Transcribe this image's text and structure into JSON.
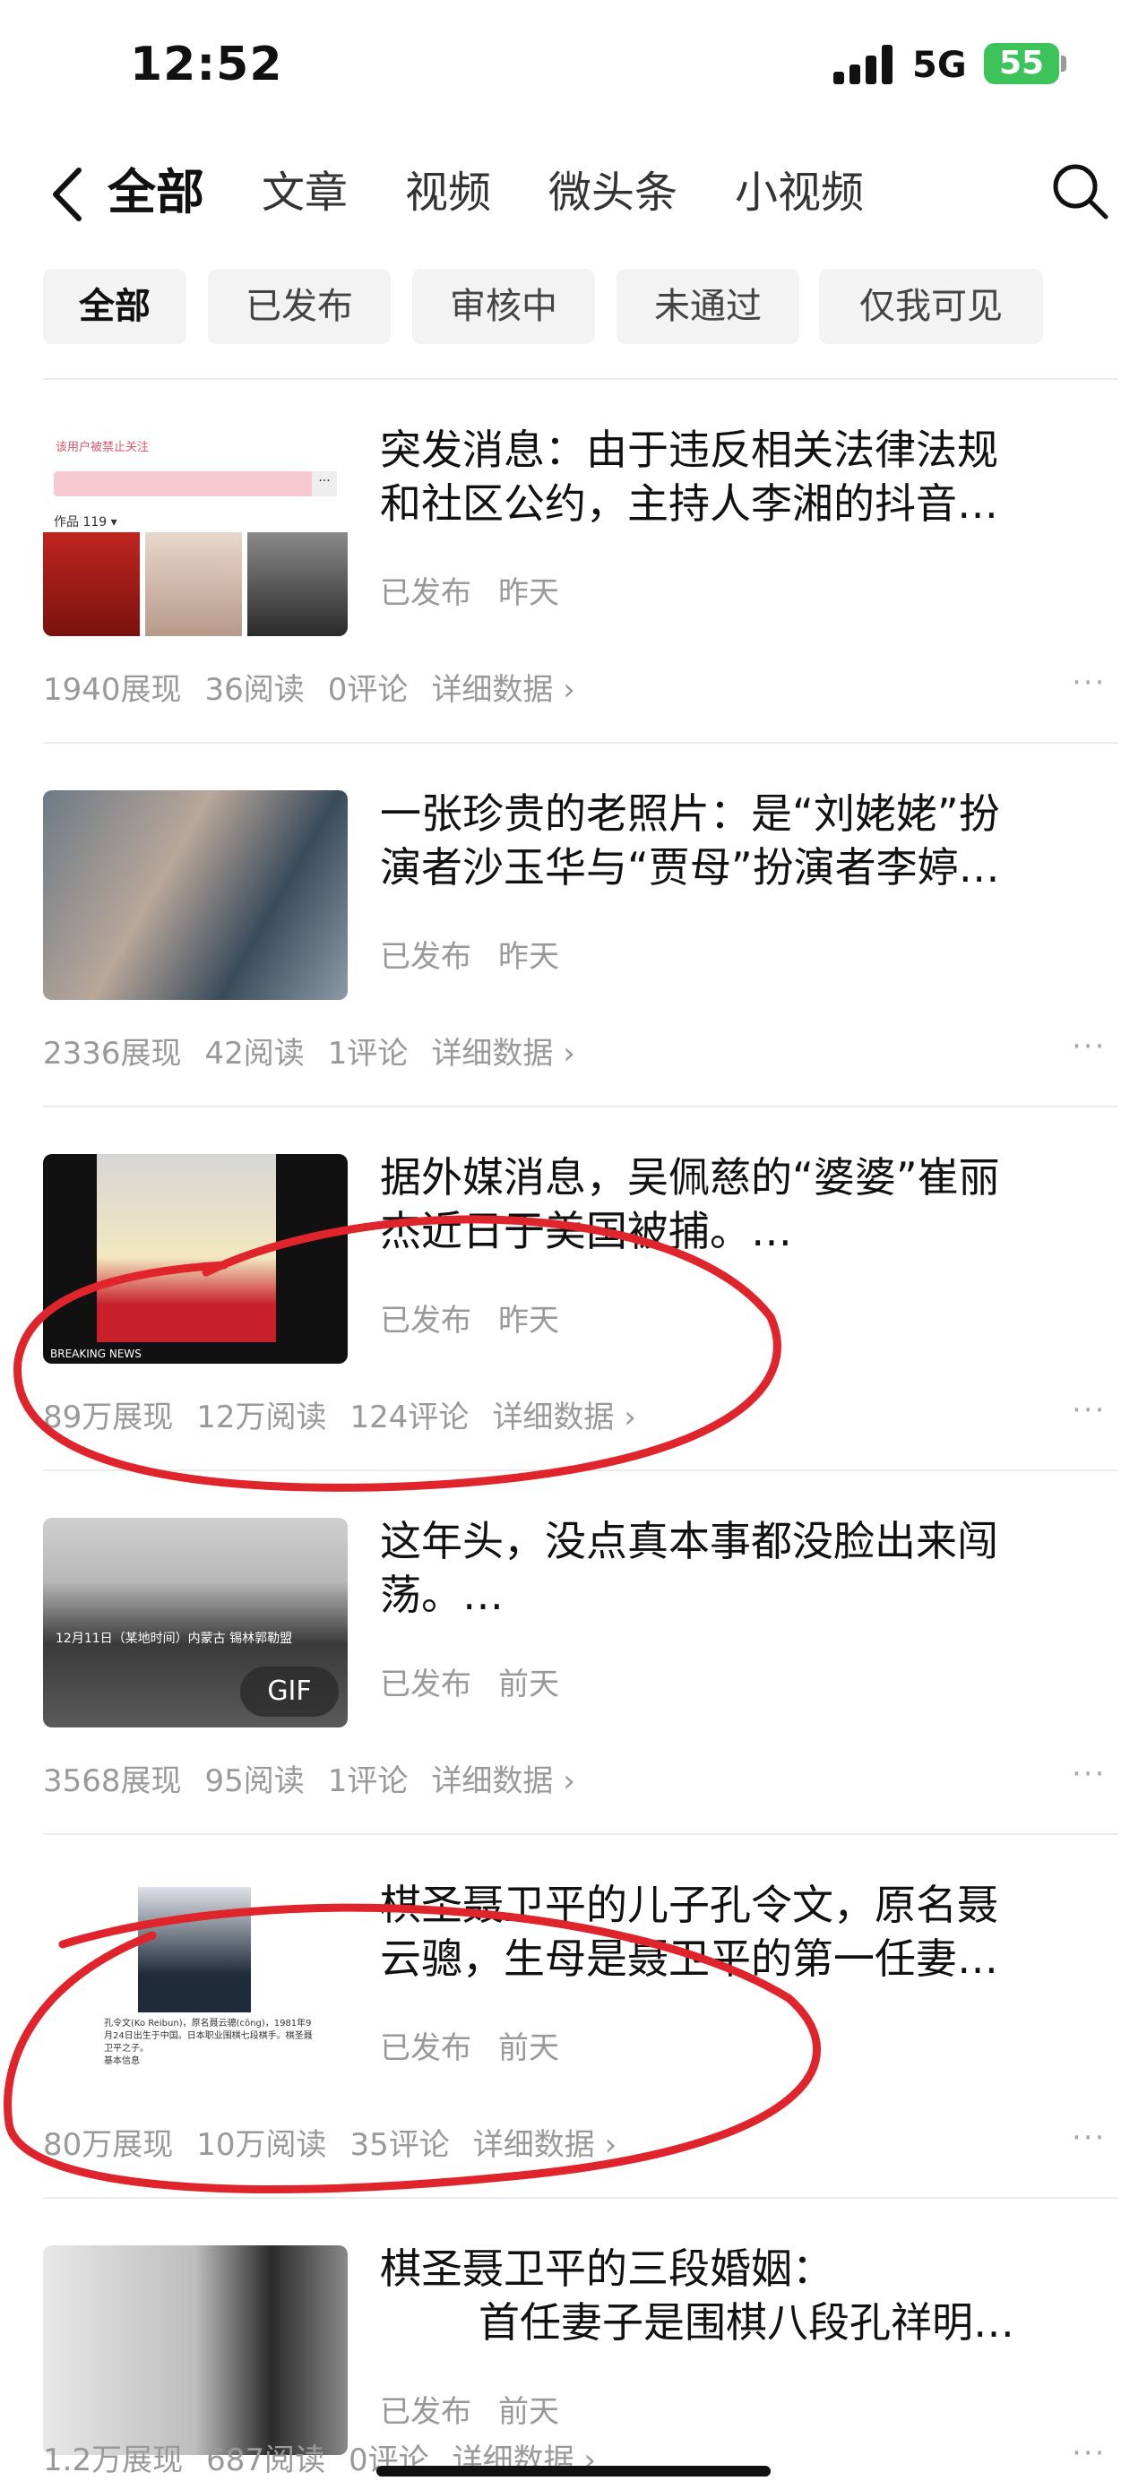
{
  "status": {
    "time": "12:52",
    "network": "5G",
    "battery": "55"
  },
  "nav": {
    "tabs": [
      "全部",
      "文章",
      "视频",
      "微头条",
      "小视频"
    ]
  },
  "filters": [
    "全部",
    "已发布",
    "审核中",
    "未通过",
    "仅我可见"
  ],
  "items": [
    {
      "title_line1": "突发消息：由于违反相关法律法规",
      "title_line2": "和社区公约，主持人李湘的抖音…",
      "status": "已发布",
      "time": "昨天",
      "impressions": "1940展现",
      "reads": "36阅读",
      "comments": "0评论",
      "detail": "详细数据 ›",
      "thumb_text": {
        "notice": "该用户被禁止关注",
        "works": "作品 119 ▾"
      }
    },
    {
      "title_line1": "一张珍贵的老照片：是“刘姥姥”扮",
      "title_line2": "演者沙玉华与“贾母”扮演者李婷…",
      "status": "已发布",
      "time": "昨天",
      "impressions": "2336展现",
      "reads": "42阅读",
      "comments": "1评论",
      "detail": "详细数据 ›"
    },
    {
      "title_line1": "据外媒消息，吴佩慈的“婆婆”崔丽",
      "title_line2": "杰近日于美国被捕。…",
      "status": "已发布",
      "time": "昨天",
      "impressions": "89万展现",
      "reads": "12万阅读",
      "comments": "124评论",
      "detail": "详细数据 ›",
      "thumb_text": {
        "news": "BREAKING NEWS"
      }
    },
    {
      "title_line1": "这年头，没点真本事都没脸出来闯",
      "title_line2": "荡。…",
      "status": "已发布",
      "time": "前天",
      "impressions": "3568展现",
      "reads": "95阅读",
      "comments": "1评论",
      "detail": "详细数据 ›",
      "thumb_text": {
        "gif": "GIF",
        "caption": "12月11日（某地时间）内蒙古 锡林郭勒盟"
      }
    },
    {
      "title_line1": "棋圣聂卫平的儿子孔令文，原名聂",
      "title_line2": "云骢，生母是聂卫平的第一任妻…",
      "status": "已发布",
      "time": "前天",
      "impressions": "80万展现",
      "reads": "10万阅读",
      "comments": "35评论",
      "detail": "详细数据 ›",
      "thumb_text": {
        "bio": "孔令文(Ko Reibun)，原名聂云骢(cōng)，1981年9月24日出生于中国。日本职业围棋七段棋手。棋圣聂卫平之子。",
        "basic": "基本信息"
      }
    },
    {
      "title_line1": "棋圣聂卫平的三段婚姻：",
      "title_line2": "首任妻子是围棋八段孔祥明…",
      "status": "已发布",
      "time": "前天",
      "impressions": "1.2万展现",
      "reads": "687阅读",
      "comments": "0评论",
      "detail": "详细数据 ›"
    }
  ],
  "more_label": "···",
  "colors": {
    "annotation": "#e0242b",
    "muted": "#999999",
    "chip_bg": "#f3f3f3",
    "battery": "#3cc45a"
  }
}
